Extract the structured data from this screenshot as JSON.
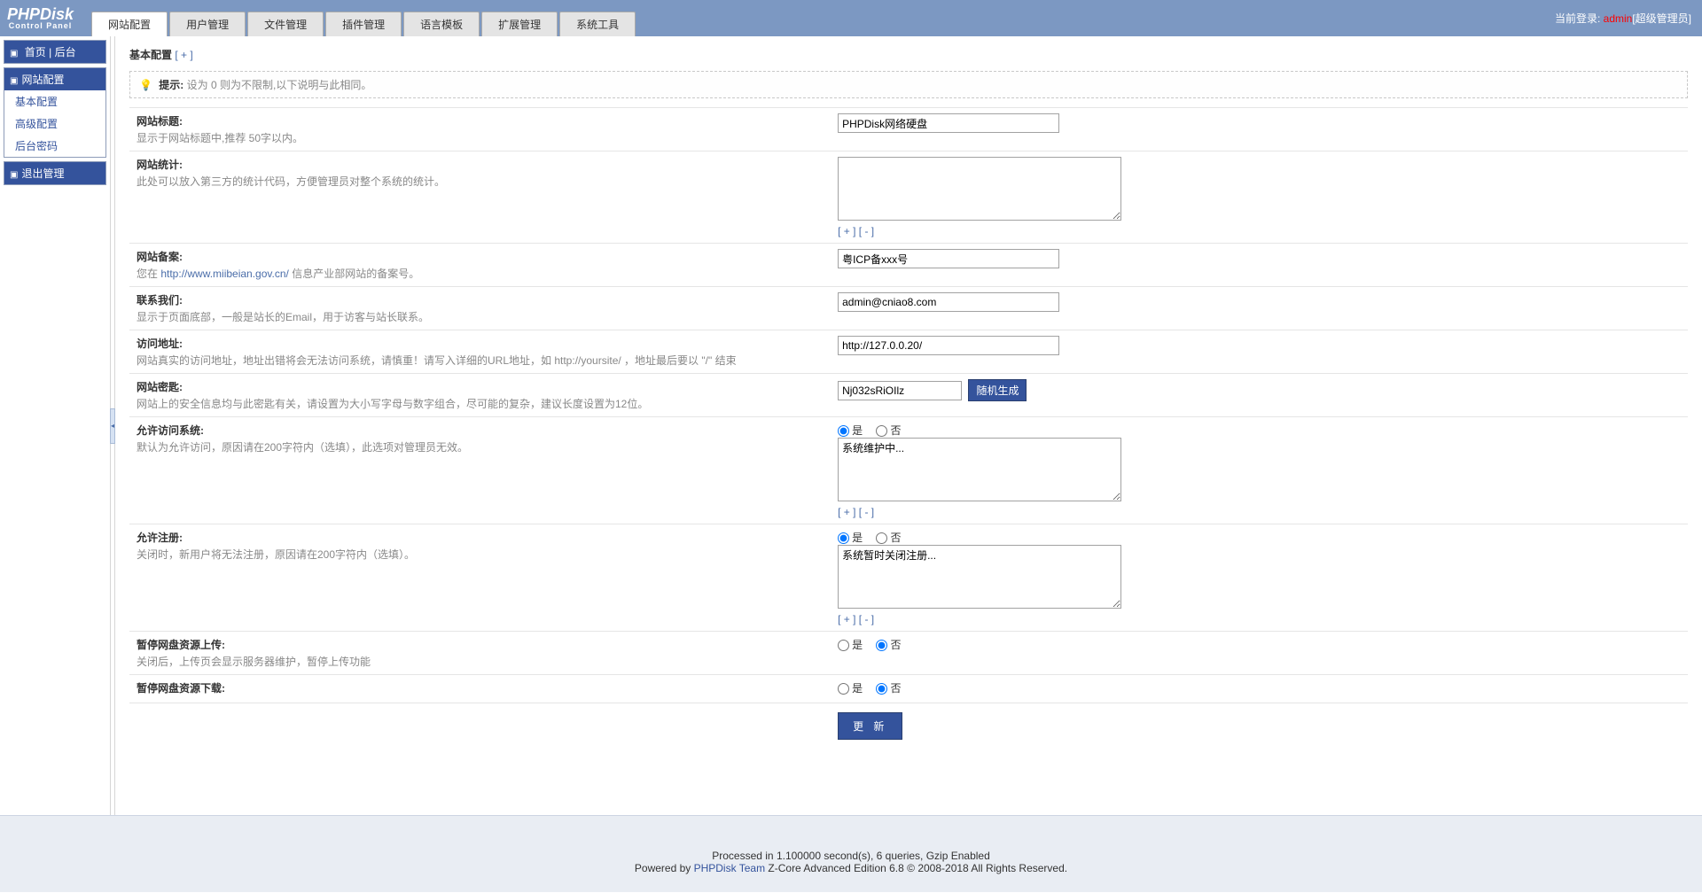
{
  "header": {
    "logo_top": "PHPDisk",
    "logo_sub": "Control Panel",
    "tabs": [
      "网站配置",
      "用户管理",
      "文件管理",
      "插件管理",
      "语言模板",
      "扩展管理",
      "系统工具"
    ],
    "login_prefix": "当前登录: ",
    "login_user": "admin",
    "login_role": "[超级管理员]"
  },
  "sidebar": {
    "top_home": "首页",
    "top_back": "后台",
    "block1_title": "网站配置",
    "block1_items": [
      "基本配置",
      "高级配置",
      "后台密码"
    ],
    "block2_title": "退出管理"
  },
  "page": {
    "title": "基本配置",
    "title_plus": "[ + ]",
    "tip_label": "提示:",
    "tip_text": "设为 0 则为不限制,以下说明与此相同。"
  },
  "fields": {
    "site_title": {
      "label": "网站标题:",
      "desc": "显示于网站标题中,推荐 50字以内。",
      "value": "PHPDisk网络硬盘"
    },
    "site_stats": {
      "label": "网站统计:",
      "desc": "此处可以放入第三方的统计代码，方便管理员对整个系统的统计。",
      "value": ""
    },
    "site_beian": {
      "label": "网站备案:",
      "desc_pre": "您在 ",
      "desc_link": "http://www.miibeian.gov.cn/",
      "desc_post": " 信息产业部网站的备案号。",
      "value": "粤ICP备xxx号"
    },
    "contact": {
      "label": "联系我们:",
      "desc": "显示于页面底部，一般是站长的Email，用于访客与站长联系。",
      "value": "admin@cniao8.com"
    },
    "visit_url": {
      "label": "访问地址:",
      "desc": "网站真实的访问地址，地址出错将会无法访问系统，请慎重！请写入详细的URL地址，如 http://yoursite/ ，地址最后要以 \"/\" 结束",
      "value": "http://127.0.0.20/"
    },
    "site_key": {
      "label": "网站密匙:",
      "desc": "网站上的安全信息均与此密匙有关，请设置为大小写字母与数字组合，尽可能的复杂，建议长度设置为12位。",
      "value": "Nj032sRiOIlz",
      "btn": "随机生成"
    },
    "allow_visit": {
      "label": "允许访问系统:",
      "desc": "默认为允许访问，原因请在200字符内（选填），此选项对管理员无效。",
      "yes": "是",
      "no": "否",
      "text": "系统维护中..."
    },
    "allow_reg": {
      "label": "允许注册:",
      "desc": "关闭时，新用户将无法注册，原因请在200字符内（选填）。",
      "yes": "是",
      "no": "否",
      "text": "系统暂时关闭注册..."
    },
    "pause_up": {
      "label": "暂停网盘资源上传:",
      "desc": "关闭后，上传页会显示服务器维护，暂停上传功能",
      "yes": "是",
      "no": "否"
    },
    "pause_down": {
      "label": "暂停网盘资源下载:",
      "yes": "是",
      "no": "否"
    }
  },
  "resize": {
    "plus": "[ + ]",
    "minus": "[ - ]"
  },
  "buttons": {
    "submit": "更 新"
  },
  "footer": {
    "line1": "Processed in 1.100000 second(s), 6 queries, Gzip Enabled",
    "line2_pre": "Powered by ",
    "line2_link": "PHPDisk Team",
    "line2_post": " Z-Core Advanced Edition 6.8 © 2008-2018 All Rights Reserved."
  }
}
